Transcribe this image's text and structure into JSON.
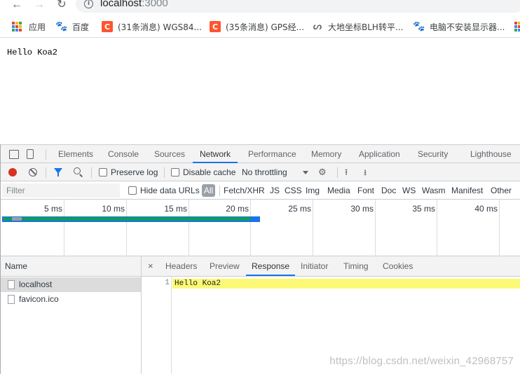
{
  "browser": {
    "nav": {
      "back_icon": "←",
      "forward_icon": "→",
      "reload_icon": "↻"
    },
    "address": {
      "info_icon": "i",
      "host": "localhost",
      "port": ":3000"
    }
  },
  "bookmarks": [
    {
      "label": "应用",
      "icon": "apps-grid-icon"
    },
    {
      "label": "百度",
      "icon": "baidu-paw-icon"
    },
    {
      "label": "(31条消息) WGS84...",
      "icon": "csdn-icon"
    },
    {
      "label": "(35条消息) GPS经...",
      "icon": "csdn-icon"
    },
    {
      "label": "大地坐标BLH转平...",
      "icon": "leaf-icon"
    },
    {
      "label": "电脑不安装显示器...",
      "icon": "baidu-paw-icon"
    }
  ],
  "page": {
    "text": "Hello Koa2"
  },
  "devtools": {
    "tabs": [
      "Elements",
      "Console",
      "Sources",
      "Network",
      "Performance",
      "Memory",
      "Application",
      "Security",
      "Lighthouse"
    ],
    "active_tab": "Network",
    "net_toolbar": {
      "preserve_log": "Preserve log",
      "disable_cache": "Disable cache",
      "throttling": "No throttling"
    },
    "filter": {
      "placeholder": "Filter",
      "hide_data_urls": "Hide data URLs",
      "types": [
        "All",
        "Fetch/XHR",
        "JS",
        "CSS",
        "Img",
        "Media",
        "Font",
        "Doc",
        "WS",
        "Wasm",
        "Manifest",
        "Other"
      ]
    },
    "timeline_ticks": [
      "5 ms",
      "10 ms",
      "15 ms",
      "20 ms",
      "25 ms",
      "30 ms",
      "35 ms",
      "40 ms"
    ],
    "requests": {
      "header": "Name",
      "rows": [
        "localhost",
        "favicon.ico"
      ],
      "selected": "localhost"
    },
    "detail": {
      "close": "×",
      "tabs": [
        "Headers",
        "Preview",
        "Response",
        "Initiator",
        "Timing",
        "Cookies"
      ],
      "active_tab": "Response",
      "response_line_number": "1",
      "response_text": "Hello Koa2"
    }
  },
  "watermark": "https://blog.csdn.net/weixin_42968757",
  "colors": {
    "record": "#d93025",
    "accent": "#1a73e8",
    "response_highlight": "#fbf976",
    "csdn": "#fc5531"
  }
}
